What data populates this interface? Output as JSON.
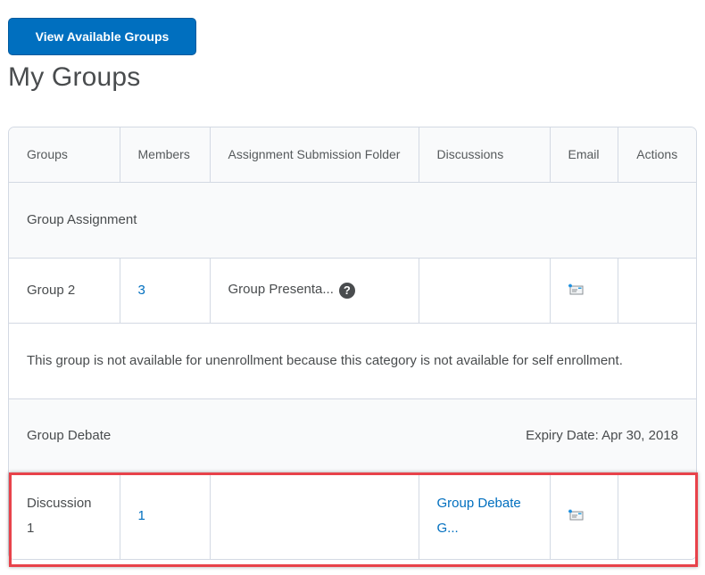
{
  "toolbar": {
    "view_groups_label": "View Available Groups"
  },
  "page": {
    "title": "My Groups"
  },
  "table": {
    "headers": {
      "groups": "Groups",
      "members": "Members",
      "assignment_folder": "Assignment Submission Folder",
      "discussions": "Discussions",
      "email": "Email",
      "actions": "Actions"
    },
    "categories": [
      {
        "name": "Group Assignment",
        "expiry": "",
        "groups": [
          {
            "name": "Group 2",
            "members": "3",
            "assignment_folder": "Group Presenta...",
            "assignment_folder_icon": "help-icon",
            "discussions": "",
            "email_icon": "email-icon",
            "actions": ""
          }
        ],
        "notice": "This group is not available for unenrollment because this category is not available for self enrollment."
      },
      {
        "name": "Group Debate",
        "expiry": "Expiry Date: Apr 30, 2018",
        "groups": [
          {
            "name": "Discussion 1",
            "members": "1",
            "assignment_folder": "",
            "discussions": "Group Debate G...",
            "email_icon": "email-icon",
            "actions": ""
          }
        ]
      }
    ]
  },
  "colors": {
    "primary": "#006fbf",
    "text": "#494c4e",
    "border": "#d3d9e3",
    "header_bg": "#f9fafb",
    "highlight": "#e8424a"
  },
  "icons": {
    "help": "?"
  }
}
